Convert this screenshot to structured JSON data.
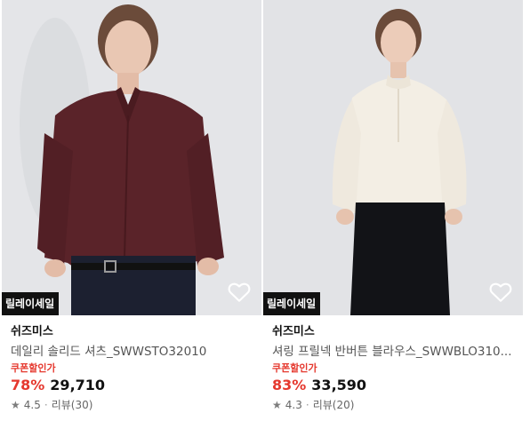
{
  "colors": {
    "accent_red": "#e5382e",
    "badge_bg": "#111111"
  },
  "products": [
    {
      "badge": "릴레이세일",
      "brand": "쉬즈미스",
      "name": "데일리 솔리드 셔츠_SWWSTO32010",
      "coupon_label": "쿠폰할인가",
      "discount": "78%",
      "price": "29,710",
      "rating": "4.5",
      "separator": "·",
      "reviews": "리뷰(30)",
      "wishlist_icon": "heart-outline-icon"
    },
    {
      "badge": "릴레이세일",
      "brand": "쉬즈미스",
      "name": "셔링 프릴넥 반버튼 블라우스_SWWBLO310...",
      "coupon_label": "쿠폰할인가",
      "discount": "83%",
      "price": "33,590",
      "rating": "4.3",
      "separator": "·",
      "reviews": "리뷰(20)",
      "wishlist_icon": "heart-outline-icon"
    }
  ]
}
